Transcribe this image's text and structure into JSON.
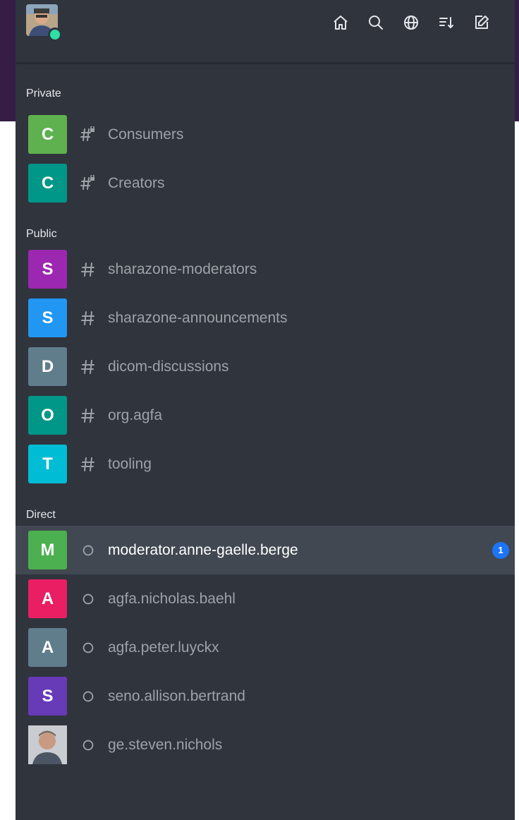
{
  "toolbar": {
    "icons": [
      "home-icon",
      "search-icon",
      "globe-icon",
      "sort-icon",
      "edit-icon"
    ]
  },
  "user": {
    "status_color": "#2de0a5"
  },
  "sections": {
    "private": {
      "title": "Private",
      "items": [
        {
          "initial": "C",
          "label": "Consumers",
          "color": "#5eb14e",
          "icon": "private-channel-icon"
        },
        {
          "initial": "C",
          "label": "Creators",
          "color": "#009688",
          "icon": "private-channel-icon"
        }
      ]
    },
    "public": {
      "title": "Public",
      "items": [
        {
          "initial": "S",
          "label": "sharazone-moderators",
          "color": "#9c27b0",
          "icon": "hash-icon"
        },
        {
          "initial": "S",
          "label": "sharazone-announcements",
          "color": "#2196f3",
          "icon": "hash-icon"
        },
        {
          "initial": "D",
          "label": "dicom-discussions",
          "color": "#607d8b",
          "icon": "hash-icon"
        },
        {
          "initial": "O",
          "label": "org.agfa",
          "color": "#009688",
          "icon": "hash-icon"
        },
        {
          "initial": "T",
          "label": "tooling",
          "color": "#00bcd4",
          "icon": "hash-icon"
        }
      ]
    },
    "direct": {
      "title": "Direct",
      "items": [
        {
          "initial": "M",
          "label": "moderator.anne-gaelle.berge",
          "color": "#4caf50",
          "icon": "offline-status-icon",
          "active": true,
          "badge": "1"
        },
        {
          "initial": "A",
          "label": "agfa.nicholas.baehl",
          "color": "#e91e63",
          "icon": "offline-status-icon"
        },
        {
          "initial": "A",
          "label": "agfa.peter.luyckx",
          "color": "#607d8b",
          "icon": "offline-status-icon"
        },
        {
          "initial": "S",
          "label": "seno.allison.bertrand",
          "color": "#673ab7",
          "icon": "offline-status-icon"
        },
        {
          "initial": "",
          "label": "ge.steven.nichols",
          "color": "#b7b9bd",
          "icon": "offline-status-icon",
          "photo": true
        }
      ]
    }
  },
  "colors": {
    "sidebar_bg": "#2f343d",
    "header_purple": "#351d46",
    "active_bg": "#414852",
    "badge_blue": "#1d74f5",
    "text_muted": "#9ea2a8"
  }
}
